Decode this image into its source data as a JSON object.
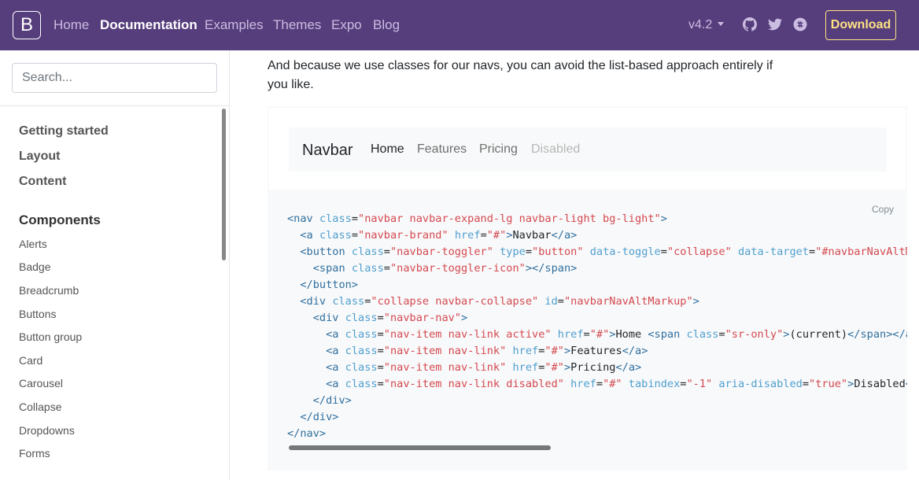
{
  "topnav": {
    "brand": "B",
    "links": [
      "Home",
      "Documentation",
      "Examples",
      "Themes",
      "Expo",
      "Blog"
    ],
    "active_index": 1,
    "version": "v4.2",
    "icons": [
      "github-icon",
      "twitter-icon",
      "slack-icon"
    ],
    "download": "Download"
  },
  "sidebar": {
    "search_placeholder": "Search...",
    "sections": [
      "Getting started",
      "Layout",
      "Content",
      "Components"
    ],
    "components": [
      "Alerts",
      "Badge",
      "Breadcrumb",
      "Buttons",
      "Button group",
      "Card",
      "Carousel",
      "Collapse",
      "Dropdowns",
      "Forms"
    ]
  },
  "main": {
    "intro": "And because we use classes for our navs, you can avoid the list-based approach entirely if you like.",
    "demo": {
      "brand": "Navbar",
      "links": [
        "Home",
        "Features",
        "Pricing",
        "Disabled"
      ]
    },
    "copy": "Copy"
  },
  "colors": {
    "topbar": "#563d7c",
    "download": "#ffe484",
    "tag": "#2f6f9f",
    "attr": "#4f9fcf",
    "string": "#d44950"
  }
}
